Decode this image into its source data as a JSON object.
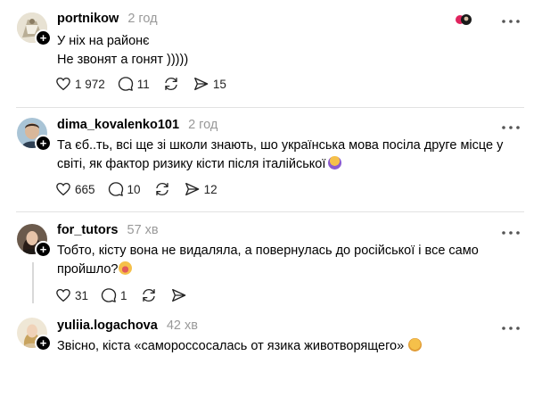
{
  "posts": [
    {
      "username": "portnikow",
      "time": "2 год",
      "lines": [
        "У ніх на районє",
        "Не звонят а гонят )))))"
      ],
      "likes": "1 972",
      "comments": "11",
      "reposts": "",
      "shares": "15"
    },
    {
      "username": "dima_kovalenko101",
      "time": "2 год",
      "lines": [
        "Та єб..ть, всі ще зі школи знають, шо українська мова посіла друге місце у",
        "світі, як фактор ризику кісти після італійської"
      ],
      "likes": "665",
      "comments": "10",
      "reposts": "",
      "shares": "12"
    },
    {
      "username": "for_tutors",
      "time": "57 хв",
      "lines": [
        "Тобто, кісту вона не видаляла, а повернулась до російської і все само",
        "пройшло?"
      ],
      "likes": "31",
      "comments": "1",
      "reposts": "",
      "shares": ""
    },
    {
      "username": "yuliia.logachova",
      "time": "42 хв",
      "lines": [
        "Звісно, кіста «самороссосалась от язика животворящего»"
      ]
    }
  ],
  "icons": {
    "more": "more-dots-icon",
    "like": "heart-icon",
    "comment": "comment-bubble-icon",
    "repost": "repost-icon",
    "share": "send-icon",
    "follow": "plus-icon"
  }
}
